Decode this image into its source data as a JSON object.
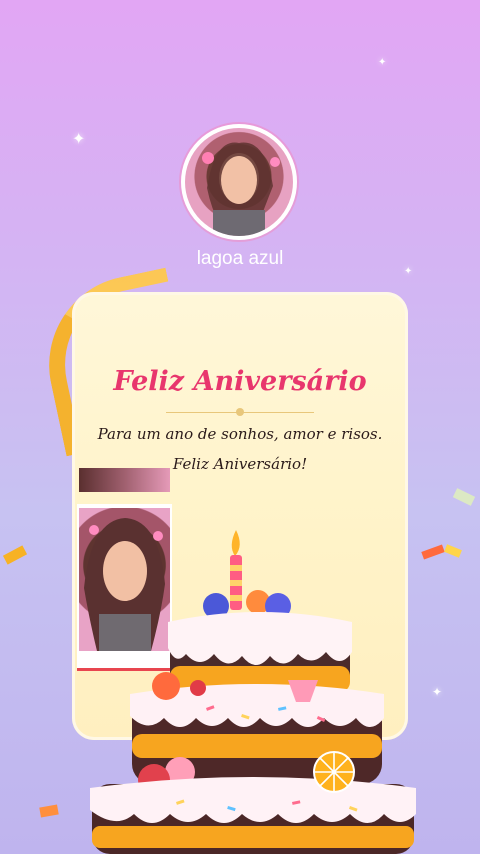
{
  "profile": {
    "username": "lagoa azul"
  },
  "card": {
    "title": "Feliz Aniversário",
    "line1": "Para um ano de sonhos, amor e risos.",
    "line2": "Feliz Aniversário!"
  },
  "colors": {
    "title": "#e8366d",
    "ribbon": "#f7b224",
    "card_bg": "#fff7d9"
  },
  "icons": [
    "sparkle-icon",
    "birthday-cake-icon",
    "candle-icon",
    "confetti-icon"
  ]
}
